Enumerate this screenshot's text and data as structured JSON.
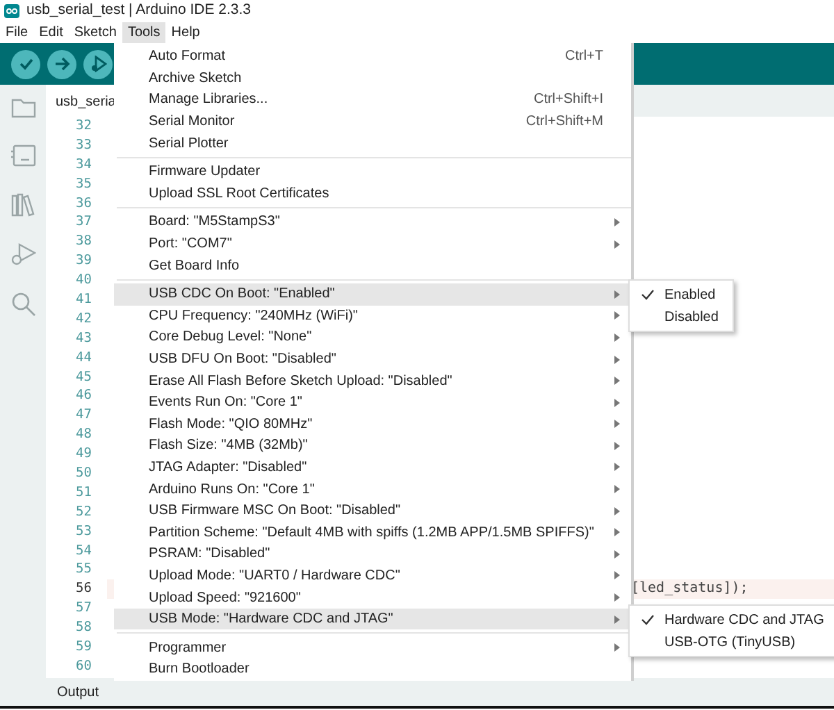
{
  "window": {
    "title": "usb_serial_test | Arduino IDE 2.3.3"
  },
  "menubar": [
    {
      "label": "File",
      "selected": false
    },
    {
      "label": "Edit",
      "selected": false
    },
    {
      "label": "Sketch",
      "selected": false
    },
    {
      "label": "Tools",
      "selected": true
    },
    {
      "label": "Help",
      "selected": false
    }
  ],
  "editor": {
    "tab": "usb_seria",
    "lines": [
      {
        "number": "32",
        "current": false
      },
      {
        "number": "33",
        "current": false
      },
      {
        "number": "34",
        "current": false
      },
      {
        "number": "35",
        "current": false
      },
      {
        "number": "36",
        "current": false
      },
      {
        "number": "37",
        "current": false
      },
      {
        "number": "38",
        "current": false
      },
      {
        "number": "39",
        "current": false
      },
      {
        "number": "40",
        "current": false
      },
      {
        "number": "41",
        "current": false
      },
      {
        "number": "42",
        "current": false
      },
      {
        "number": "43",
        "current": false
      },
      {
        "number": "44",
        "current": false
      },
      {
        "number": "45",
        "current": false
      },
      {
        "number": "46",
        "current": false
      },
      {
        "number": "47",
        "current": false
      },
      {
        "number": "48",
        "current": false
      },
      {
        "number": "49",
        "current": false
      },
      {
        "number": "50",
        "current": false
      },
      {
        "number": "51",
        "current": false
      },
      {
        "number": "52",
        "current": false
      },
      {
        "number": "53",
        "current": false
      },
      {
        "number": "54",
        "current": false
      },
      {
        "number": "55",
        "current": false
      },
      {
        "number": "56",
        "current": true,
        "tokens": [
          {
            "text": "[led_status]);",
            "kind": "plain"
          }
        ]
      },
      {
        "number": "57",
        "current": false
      },
      {
        "number": "58",
        "current": false
      },
      {
        "number": "59",
        "current": false
      },
      {
        "number": "60",
        "current": false
      }
    ]
  },
  "output_panel": {
    "tab": "Output"
  },
  "tools_menu": [
    {
      "kind": "item",
      "label": "Auto Format",
      "shortcut": "Ctrl+T"
    },
    {
      "kind": "item",
      "label": "Archive Sketch"
    },
    {
      "kind": "item",
      "label": "Manage Libraries...",
      "shortcut": "Ctrl+Shift+I"
    },
    {
      "kind": "item",
      "label": "Serial Monitor",
      "shortcut": "Ctrl+Shift+M"
    },
    {
      "kind": "item",
      "label": "Serial Plotter"
    },
    {
      "kind": "separator"
    },
    {
      "kind": "item",
      "label": "Firmware Updater"
    },
    {
      "kind": "item",
      "label": "Upload SSL Root Certificates"
    },
    {
      "kind": "separator"
    },
    {
      "kind": "submenu",
      "label": "Board: \"M5StampS3\"",
      "highlighted": false
    },
    {
      "kind": "submenu",
      "label": "Port: \"COM7\"",
      "highlighted": false
    },
    {
      "kind": "item",
      "label": "Get Board Info"
    },
    {
      "kind": "separator"
    },
    {
      "kind": "submenu",
      "label": "USB CDC On Boot: \"Enabled\"",
      "highlighted": true,
      "options": [
        {
          "label": "Enabled",
          "checked": true
        },
        {
          "label": "Disabled",
          "checked": false
        }
      ]
    },
    {
      "kind": "submenu",
      "label": "CPU Frequency: \"240MHz (WiFi)\"",
      "highlighted": false
    },
    {
      "kind": "submenu",
      "label": "Core Debug Level: \"None\"",
      "highlighted": false
    },
    {
      "kind": "submenu",
      "label": "USB DFU On Boot: \"Disabled\"",
      "highlighted": false
    },
    {
      "kind": "submenu",
      "label": "Erase All Flash Before Sketch Upload: \"Disabled\"",
      "highlighted": false
    },
    {
      "kind": "submenu",
      "label": "Events Run On: \"Core 1\"",
      "highlighted": false
    },
    {
      "kind": "submenu",
      "label": "Flash Mode: \"QIO 80MHz\"",
      "highlighted": false
    },
    {
      "kind": "submenu",
      "label": "Flash Size: \"4MB (32Mb)\"",
      "highlighted": false
    },
    {
      "kind": "submenu",
      "label": "JTAG Adapter: \"Disabled\"",
      "highlighted": false
    },
    {
      "kind": "submenu",
      "label": "Arduino Runs On: \"Core 1\"",
      "highlighted": false
    },
    {
      "kind": "submenu",
      "label": "USB Firmware MSC On Boot: \"Disabled\"",
      "highlighted": false
    },
    {
      "kind": "submenu",
      "label": "Partition Scheme: \"Default 4MB with spiffs (1.2MB APP/1.5MB SPIFFS)\"",
      "highlighted": false
    },
    {
      "kind": "submenu",
      "label": "PSRAM: \"Disabled\"",
      "highlighted": false
    },
    {
      "kind": "submenu",
      "label": "Upload Mode: \"UART0 / Hardware CDC\"",
      "highlighted": false
    },
    {
      "kind": "submenu",
      "label": "Upload Speed: \"921600\"",
      "highlighted": false
    },
    {
      "kind": "submenu",
      "label": "USB Mode: \"Hardware CDC and JTAG\"",
      "highlighted": true,
      "options": [
        {
          "label": "Hardware CDC and JTAG",
          "checked": true
        },
        {
          "label": "USB-OTG (TinyUSB)",
          "checked": false
        }
      ]
    },
    {
      "kind": "separator"
    },
    {
      "kind": "submenu",
      "label": "Programmer",
      "highlighted": false
    },
    {
      "kind": "item",
      "label": "Burn Bootloader"
    }
  ]
}
